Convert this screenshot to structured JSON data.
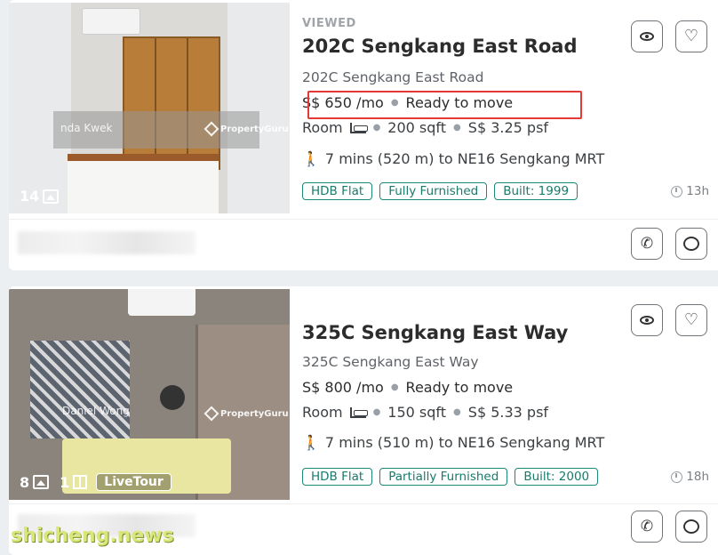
{
  "listings": [
    {
      "status_label": "VIEWED",
      "title": "202C Sengkang East Road",
      "address": "202C Sengkang East Road",
      "price": "S$ 650 /mo",
      "availability": "Ready to move",
      "room_type": "Room",
      "size": "200 sqft",
      "psf": "S$ 3.25 psf",
      "mrt": "7 mins (520 m) to NE16 Sengkang MRT",
      "tags": [
        "HDB Flat",
        "Fully Furnished",
        "Built: 1999"
      ],
      "time_ago": "13h",
      "photo_count": "14",
      "agent_watermark": "nda Kwek",
      "brand_watermark": "PropertyGuru"
    },
    {
      "status_label": "",
      "title": "325C Sengkang East Way",
      "address": "325C Sengkang East Way",
      "price": "S$ 800 /mo",
      "availability": "Ready to move",
      "room_type": "Room",
      "size": "150 sqft",
      "psf": "S$ 5.33 psf",
      "mrt": "7 mins (510 m) to NE16 Sengkang MRT",
      "tags": [
        "HDB Flat",
        "Partially Furnished",
        "Built: 2000"
      ],
      "time_ago": "18h",
      "photo_count": "8",
      "floorplan_count": "1",
      "livetour_label": "LiveTour",
      "agent_watermark": "Daniel Wong",
      "brand_watermark": "PropertyGuru"
    }
  ],
  "icons": {
    "hide": "eye-icon",
    "save": "heart-icon",
    "call": "phone-icon",
    "message": "chat-icon",
    "walk": "walk-icon",
    "clock": "clock-icon"
  },
  "site_watermark": "shicheng.news",
  "colors": {
    "tag_border": "#1a8a7a",
    "highlight_box": "#e53935",
    "background": "#eceff1"
  }
}
